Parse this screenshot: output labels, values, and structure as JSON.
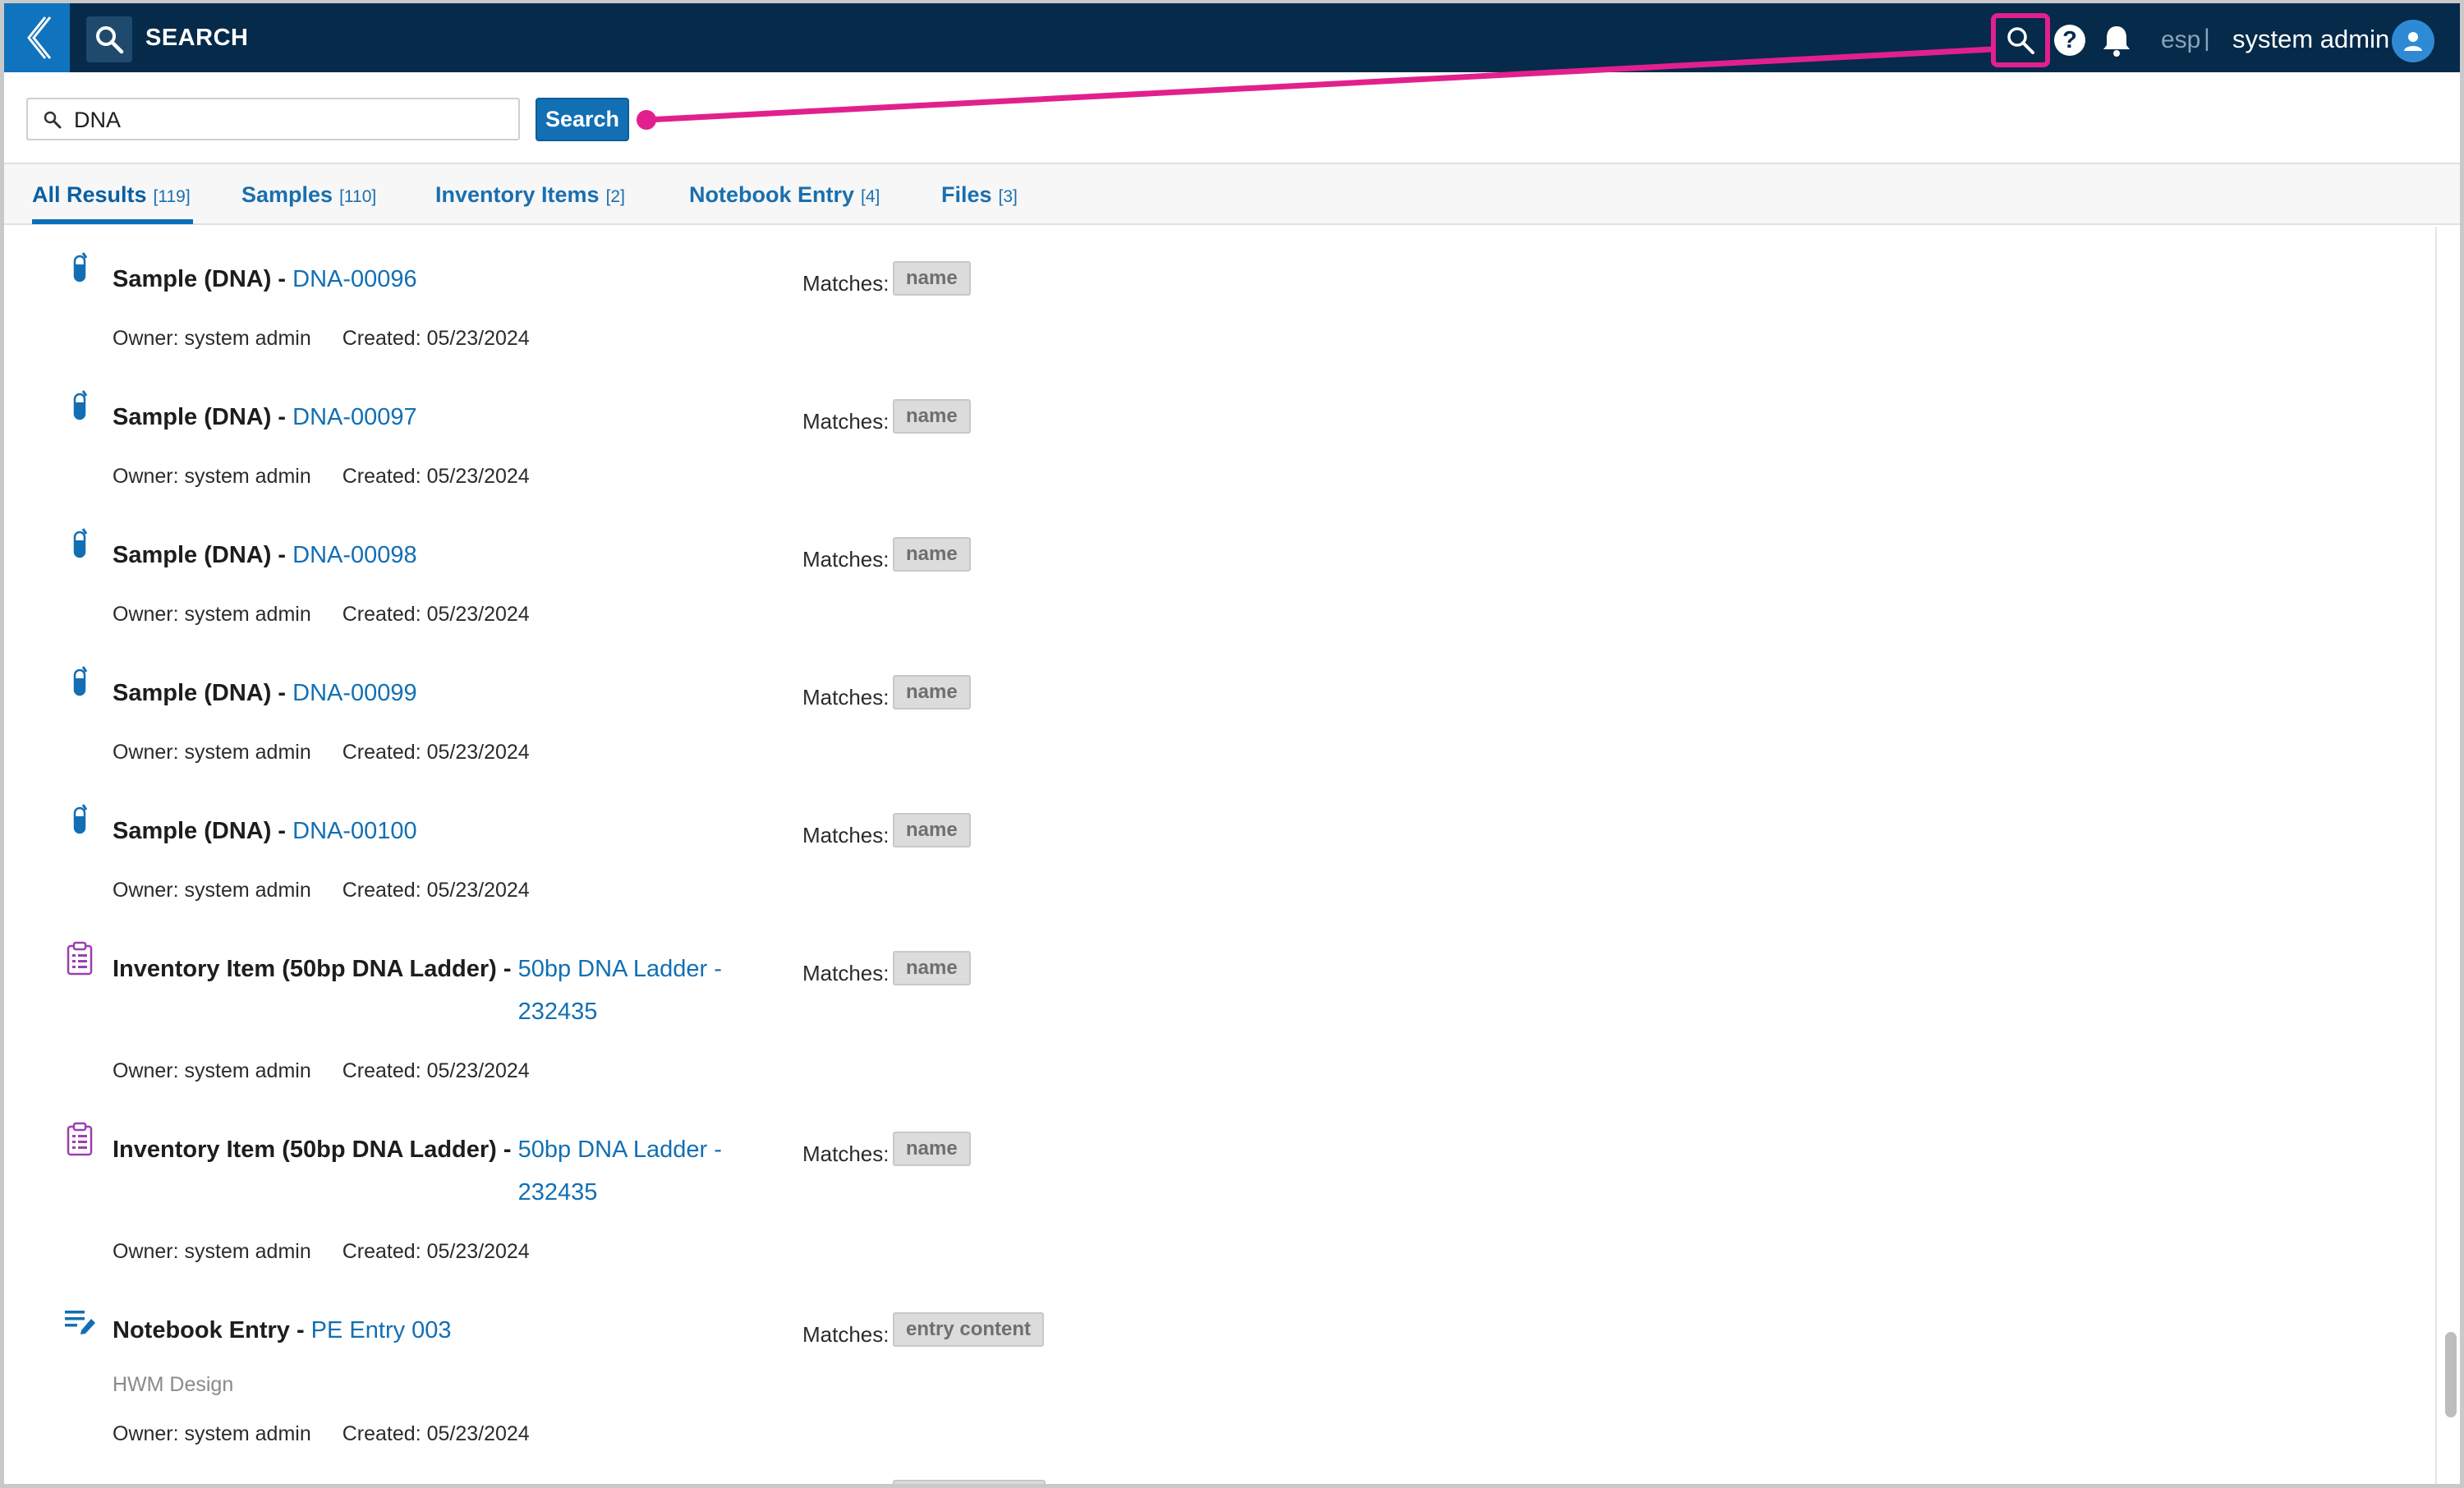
{
  "topbar": {
    "title": "SEARCH",
    "org": "esp",
    "separator": "|",
    "user": "system admin"
  },
  "search": {
    "query": "DNA",
    "button_label": "Search"
  },
  "tabs": [
    {
      "label": "All Results",
      "count": "[119]",
      "active": true
    },
    {
      "label": "Samples",
      "count": "[110]"
    },
    {
      "label": "Inventory Items",
      "count": "[2]"
    },
    {
      "label": "Notebook Entry",
      "count": "[4]"
    },
    {
      "label": "Files",
      "count": "[3]"
    }
  ],
  "results": [
    {
      "icon": "test-tube-icon",
      "type": "Sample (DNA) - ",
      "link": "DNA-00096",
      "owner": "Owner: system admin",
      "created": "Created: 05/23/2024",
      "matches_label": "Matches:",
      "match": "name"
    },
    {
      "icon": "test-tube-icon",
      "type": "Sample (DNA) - ",
      "link": "DNA-00097",
      "owner": "Owner: system admin",
      "created": "Created: 05/23/2024",
      "matches_label": "Matches:",
      "match": "name"
    },
    {
      "icon": "test-tube-icon",
      "type": "Sample (DNA) - ",
      "link": "DNA-00098",
      "owner": "Owner: system admin",
      "created": "Created: 05/23/2024",
      "matches_label": "Matches:",
      "match": "name"
    },
    {
      "icon": "test-tube-icon",
      "type": "Sample (DNA) - ",
      "link": "DNA-00099",
      "owner": "Owner: system admin",
      "created": "Created: 05/23/2024",
      "matches_label": "Matches:",
      "match": "name"
    },
    {
      "icon": "test-tube-icon",
      "type": "Sample (DNA) - ",
      "link": "DNA-00100",
      "owner": "Owner: system admin",
      "created": "Created: 05/23/2024",
      "matches_label": "Matches:",
      "match": "name"
    },
    {
      "icon": "clipboard-list-icon",
      "type": "Inventory Item (50bp DNA Ladder) - ",
      "link_line1": "50bp DNA Ladder -",
      "link_line2": "232435",
      "owner": "Owner: system admin",
      "created": "Created: 05/23/2024",
      "matches_label": "Matches:",
      "match": "name"
    },
    {
      "icon": "clipboard-list-icon",
      "type": "Inventory Item (50bp DNA Ladder) - ",
      "link_line1": "50bp DNA Ladder -",
      "link_line2": "232435",
      "owner": "Owner: system admin",
      "created": "Created: 05/23/2024",
      "matches_label": "Matches:",
      "match": "name"
    },
    {
      "icon": "notebook-edit-icon",
      "type": "Notebook Entry - ",
      "link": "PE Entry 003",
      "subtitle": "HWM Design",
      "owner": "Owner: system admin",
      "created": "Created: 05/23/2024",
      "matches_label": "Matches:",
      "match": "entry content"
    }
  ],
  "colors": {
    "topbar": "#062a49",
    "accent": "#126fb3",
    "highlight": "#e2208d",
    "inventory_icon": "#9b3fb0"
  }
}
